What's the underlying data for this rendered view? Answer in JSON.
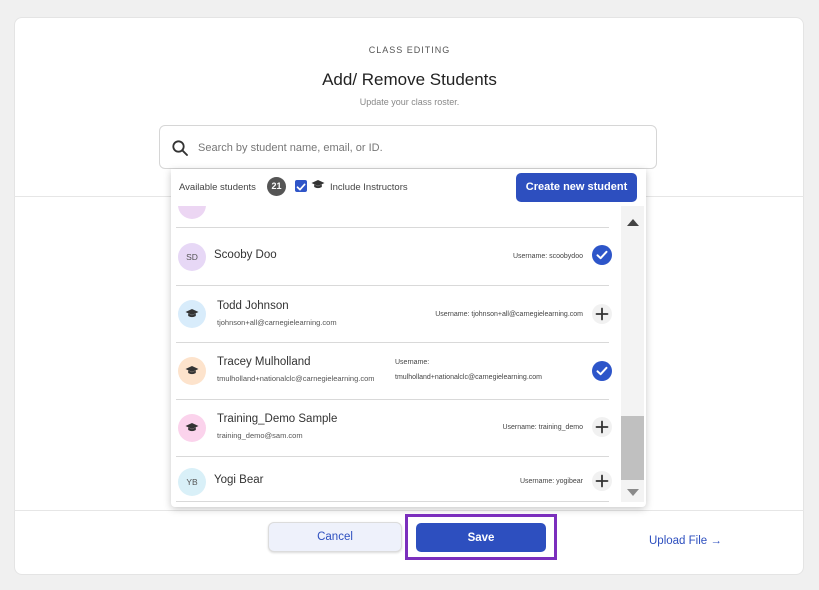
{
  "header": {
    "eyebrow": "CLASS EDITING",
    "title": "Add/ Remove Students",
    "subtitle": "Update your class roster."
  },
  "search": {
    "placeholder": "Search by student name, email, or ID.",
    "icon": "search-icon"
  },
  "panel": {
    "available_label": "Available students",
    "count": "21",
    "include_instructors_checked": true,
    "include_instructors_label": "Include Instructors",
    "create_button": "Create new student"
  },
  "students": [
    {
      "initials": "SD",
      "avatar_color": "#e7d8f6",
      "name": "Scooby Doo",
      "email": "",
      "username": "Username: scoobydoo",
      "selected": true
    },
    {
      "initials": "",
      "avatar_icon": "graduation-cap-icon",
      "avatar_color": "#d8ecfb",
      "name": "Todd Johnson",
      "email": "tjohnson+all@carnegielearning.com",
      "username": "Username: tjohnson+all@carnegielearning.com",
      "selected": false
    },
    {
      "initials": "",
      "avatar_icon": "graduation-cap-icon",
      "avatar_color": "#fde3cc",
      "name": "Tracey Mulholland",
      "email": "tmulholland+nationalclc@carnegielearning.com",
      "username_label": "Username:",
      "username_value": "tmulholland+nationalclc@carnegielearning.com",
      "selected": true
    },
    {
      "initials": "",
      "avatar_icon": "graduation-cap-icon",
      "avatar_color": "#fbd3ec",
      "name": "Training_Demo Sample",
      "email": "training_demo@sam.com",
      "username": "Username: training_demo",
      "selected": false
    },
    {
      "initials": "YB",
      "avatar_color": "#d9f0f8",
      "name": "Yogi Bear",
      "email": "",
      "username": "Username: yogibear",
      "selected": false
    }
  ],
  "footer": {
    "cancel": "Cancel",
    "save": "Save",
    "upload": "Upload File →"
  },
  "colors": {
    "primary": "#2d4fbf",
    "highlight": "#7b2fbd",
    "selected_check": "#2d55c9"
  }
}
